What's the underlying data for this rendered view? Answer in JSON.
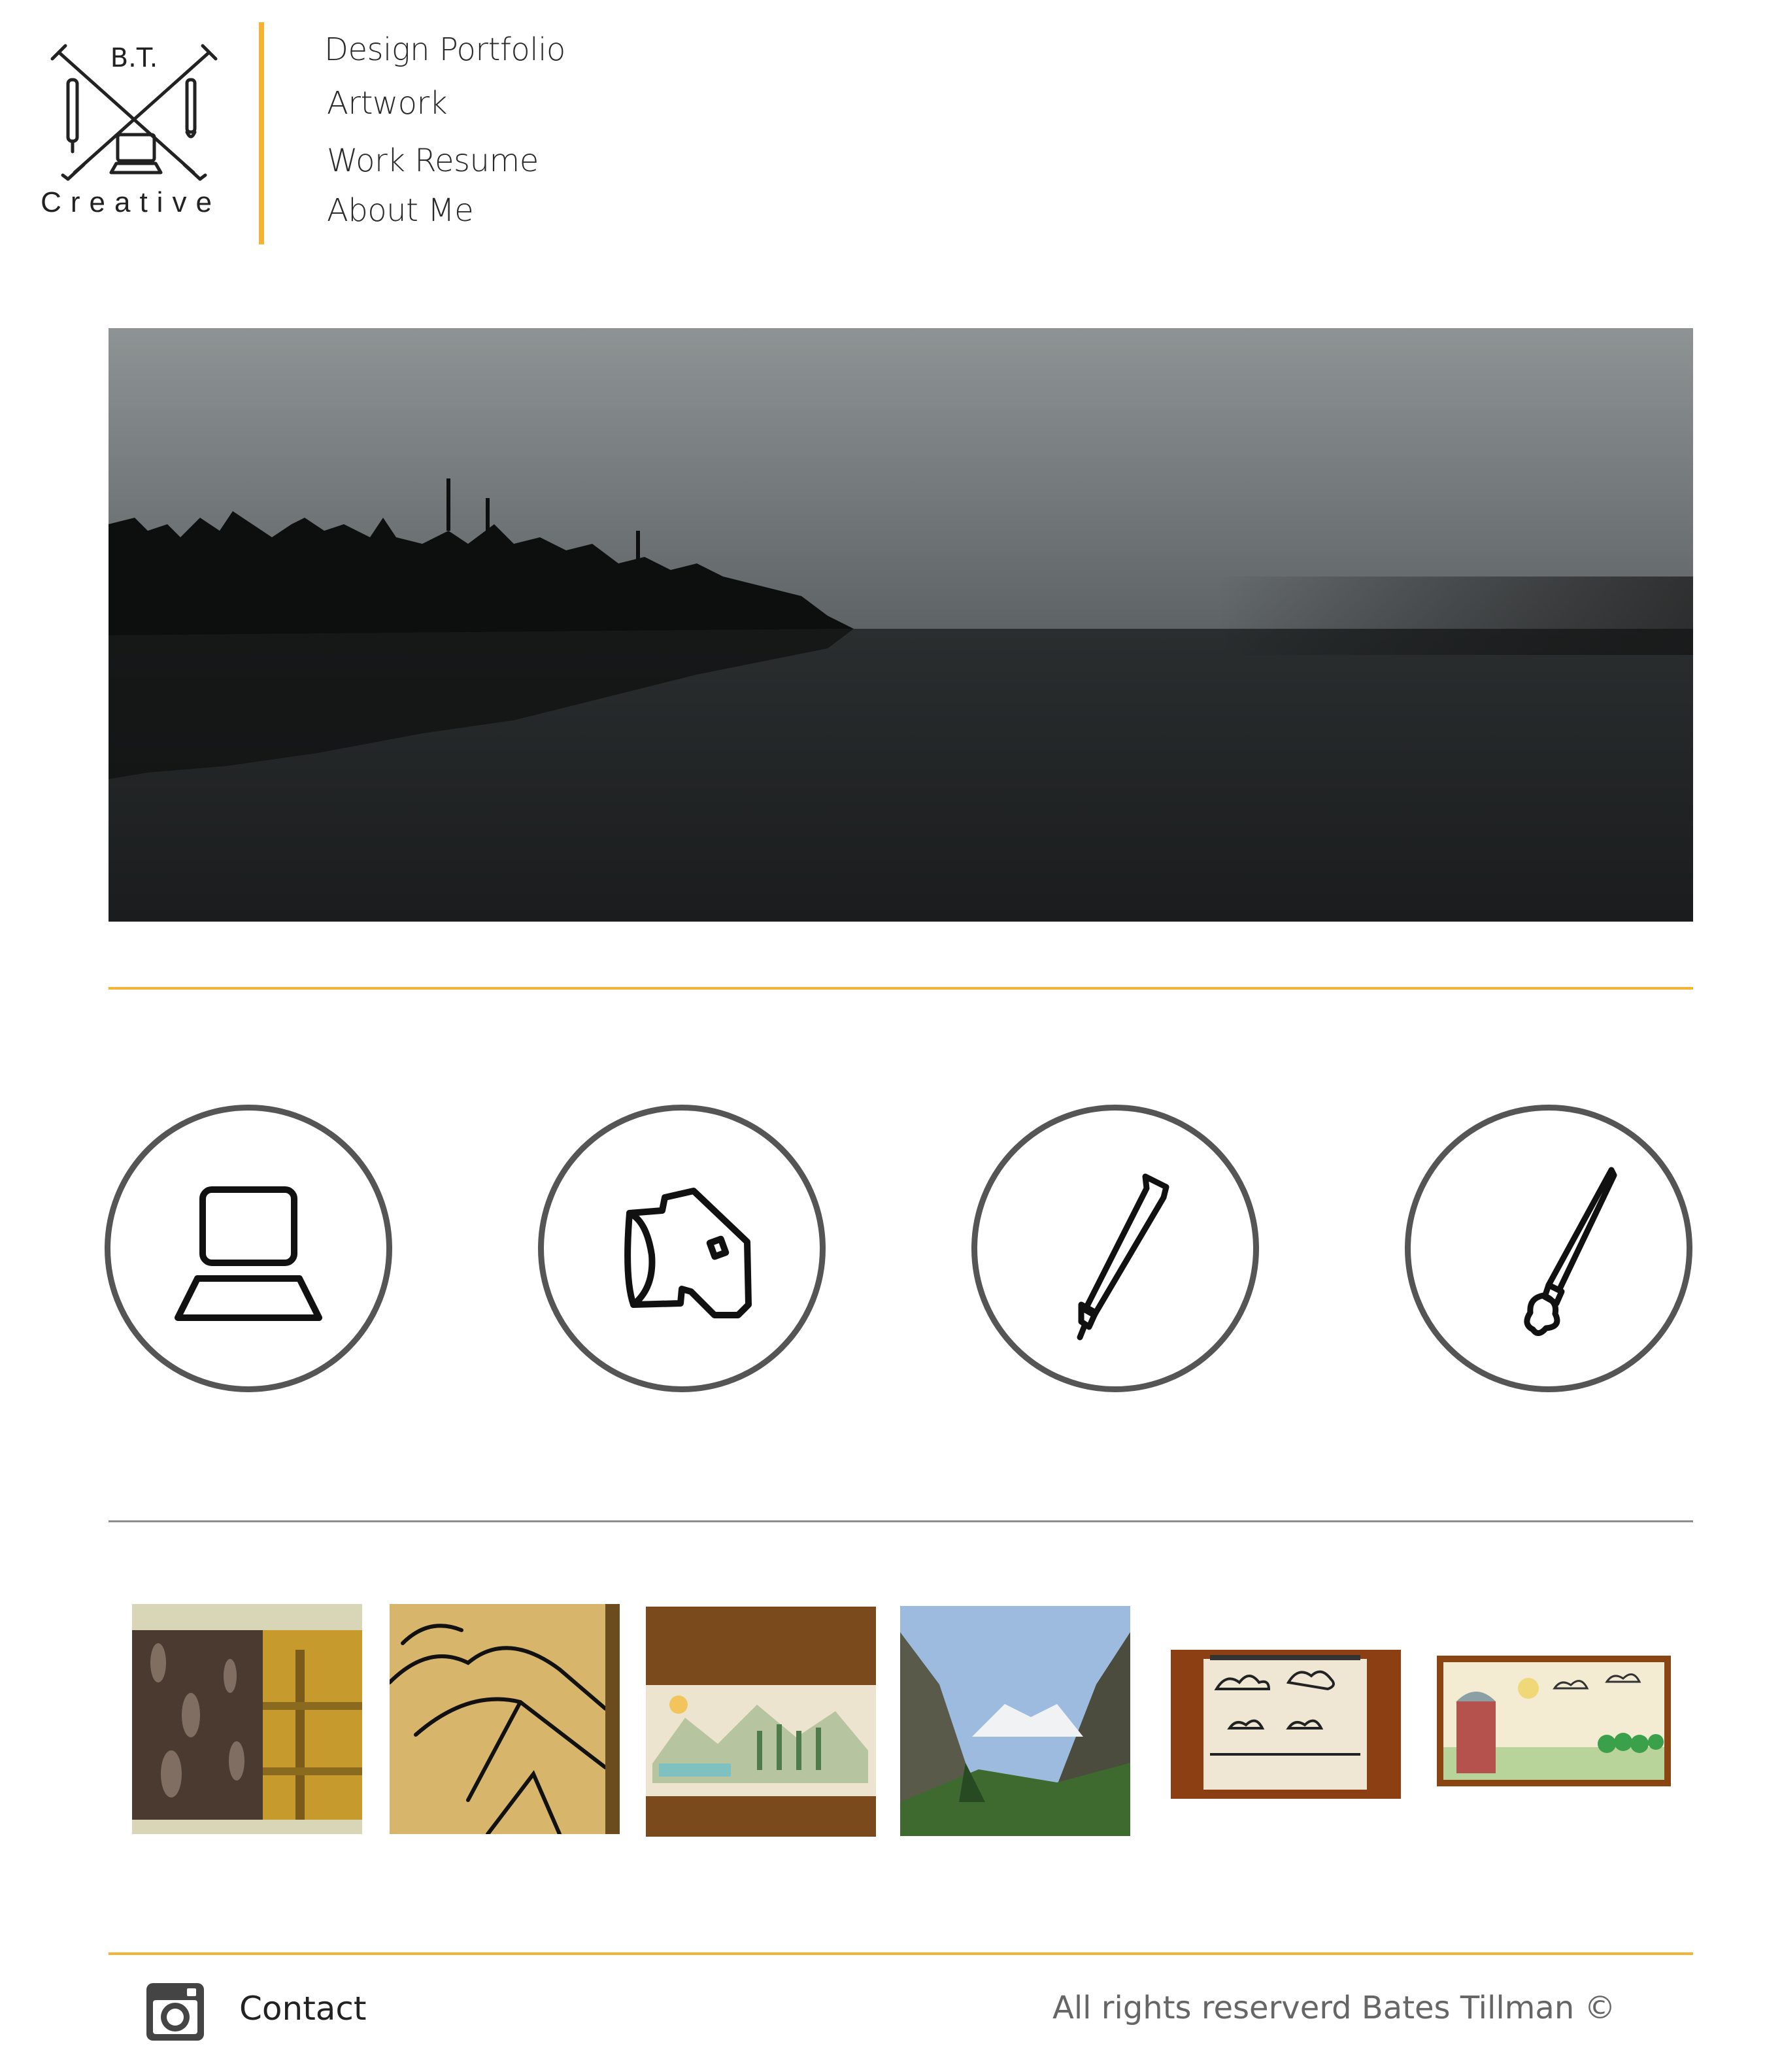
{
  "logo": {
    "monogram": "B.T.",
    "wordmark": "Creative"
  },
  "nav": {
    "items": [
      {
        "label": "Design Portfolio"
      },
      {
        "label": "Artwork"
      },
      {
        "label": "Work Resume"
      },
      {
        "label": "About Me"
      }
    ]
  },
  "hero": {
    "icon": "foggy-lake-photo"
  },
  "categories": [
    {
      "icon": "laptop-icon"
    },
    {
      "icon": "camera-icon"
    },
    {
      "icon": "pen-icon"
    },
    {
      "icon": "paintbrush-icon"
    }
  ],
  "gallery": [
    {
      "icon": "tree-bark-photo"
    },
    {
      "icon": "mountain-ink-drawing"
    },
    {
      "icon": "watercolor-sketch-landscape"
    },
    {
      "icon": "alpine-valley-photo"
    },
    {
      "icon": "cloud-sketchbook-drawing"
    },
    {
      "icon": "silo-watercolor-drawing"
    }
  ],
  "footer": {
    "contact_label": "Contact",
    "copyright": "All rights reserverd Bates Tillman ©",
    "icon": "instagram-icon"
  },
  "colors": {
    "accent": "#f5b335",
    "circle_border": "#555555",
    "divider_grey": "#8d8d8d",
    "copyright_text": "#666666"
  }
}
